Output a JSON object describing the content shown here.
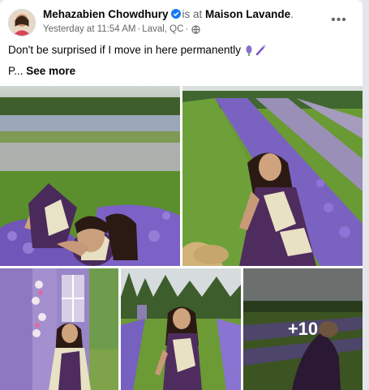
{
  "post": {
    "author": "Mehazabien Chowdhury",
    "is_at": "is at",
    "place": "Maison Lavande",
    "place_suffix": ".",
    "timestamp": "Yesterday at 11:54 AM",
    "location": "Laval, QC",
    "separator": "·",
    "privacy_icon": "globe-icon",
    "text_line": "Don't be surprised if I move in here permanently",
    "truncated_prefix": "P...",
    "see_more": "See more",
    "more_icon": "•••"
  },
  "photos": {
    "more_count": "+10"
  },
  "colors": {
    "verified": "#1877f2",
    "meta_text": "#65676b",
    "lavender": "#6a4fb3",
    "grass": "#5f9a32"
  }
}
